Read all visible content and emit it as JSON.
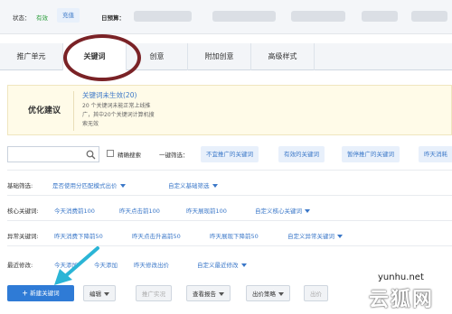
{
  "status": {
    "label": "状态：",
    "value": "有效",
    "recharge": "充值",
    "budget_label": "日预算："
  },
  "tabs": [
    {
      "label": "推广单元"
    },
    {
      "label": "关键词",
      "active": true
    },
    {
      "label": "创意"
    },
    {
      "label": "附加创意"
    },
    {
      "label": "高级样式"
    }
  ],
  "suggestion": {
    "title": "优化建议",
    "headline": "关键词未生效(20)",
    "desc_lines": [
      "20 个关键词未能正常上线推",
      "广，其中20个关键词计算机搜",
      "索无效"
    ]
  },
  "search": {
    "placeholder": "",
    "exact_label": "精确搜索"
  },
  "quick_filter": {
    "label": "一键筛选：",
    "items": [
      "不宜推广的关键词",
      "有效的关键词",
      "暂停推广的关键词",
      "昨天消耗"
    ]
  },
  "rows": {
    "basic": {
      "label": "基础筛选:",
      "items": [
        "是否使用分匹配模式出价",
        "自定义基础筛选"
      ]
    },
    "core": {
      "label": "核心关键词:",
      "items": [
        "今天消费前100",
        "昨天点击前100",
        "昨天展现前100",
        "自定义核心关键词"
      ]
    },
    "abnormal": {
      "label": "异常关键词:",
      "items": [
        "昨天消费下降前50",
        "昨天点击升高前50",
        "昨天展现下降前50",
        "自定义异常关键词"
      ]
    },
    "recent": {
      "label": "最近修改:",
      "items": [
        "今天添加",
        "今天添加",
        "昨天修改出价",
        "自定义最近修改"
      ]
    }
  },
  "toolbar": {
    "new_keyword": "新建关键词",
    "edit": "编辑",
    "promote": "推广实况",
    "report": "查看报告",
    "strategy": "出价策略",
    "more": "出价"
  },
  "watermark": {
    "site": "yunhu.net",
    "name": "云狐网"
  },
  "colors": {
    "accent": "#2f7bd6",
    "link": "#3a77c8",
    "highlight_circle": "#7a2226",
    "arrow": "#2bb5d6",
    "status_ok": "#2a9d3a"
  }
}
